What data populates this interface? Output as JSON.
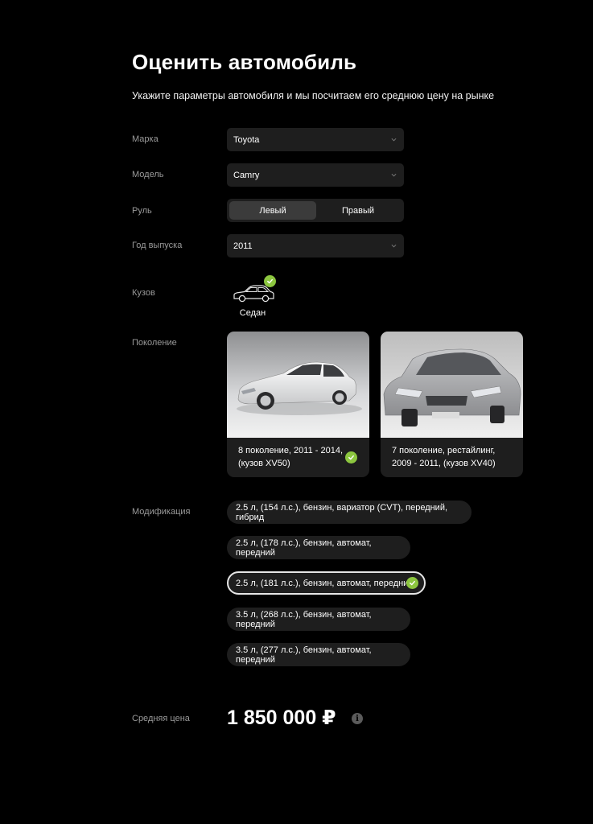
{
  "page": {
    "title": "Оценить автомобиль",
    "subtitle": "Укажите параметры автомобиля и мы посчитаем его среднюю цену на рынке"
  },
  "form": {
    "brand": {
      "label": "Марка",
      "value": "Toyota"
    },
    "model": {
      "label": "Модель",
      "value": "Camry"
    },
    "steering": {
      "label": "Руль",
      "options": [
        "Левый",
        "Правый"
      ],
      "selected": "Левый"
    },
    "year": {
      "label": "Год выпуска",
      "value": "2011"
    },
    "body": {
      "label": "Кузов",
      "selected": "Седан",
      "icon": "sedan-icon"
    },
    "generation": {
      "label": "Поколение",
      "options": [
        {
          "text": "8 поколение, 2011 - 2014, (кузов XV50)",
          "selected": true
        },
        {
          "text": "7 поколение, рестайлинг, 2009 - 2011, (кузов XV40)",
          "selected": false
        }
      ]
    },
    "modification": {
      "label": "Модификация",
      "options": [
        {
          "text": "2.5 л, (154 л.с.), бензин, вариатор (CVT), передний, гибрид",
          "selected": false
        },
        {
          "text": "2.5 л, (178 л.с.), бензин, автомат, передний",
          "selected": false
        },
        {
          "text": "2.5 л, (181 л.с.), бензин, автомат, передний",
          "selected": true
        },
        {
          "text": "3.5 л, (268 л.с.), бензин, автомат, передний",
          "selected": false
        },
        {
          "text": "3.5 л, (277 л.с.), бензин, автомат, передний",
          "selected": false
        }
      ]
    }
  },
  "price": {
    "label": "Средняя цена",
    "value": "1 850 000 ₽",
    "info_icon": "info-icon"
  },
  "colors": {
    "accent_check": "#8cc63f",
    "background": "#000000",
    "field": "#1e1e1e"
  }
}
